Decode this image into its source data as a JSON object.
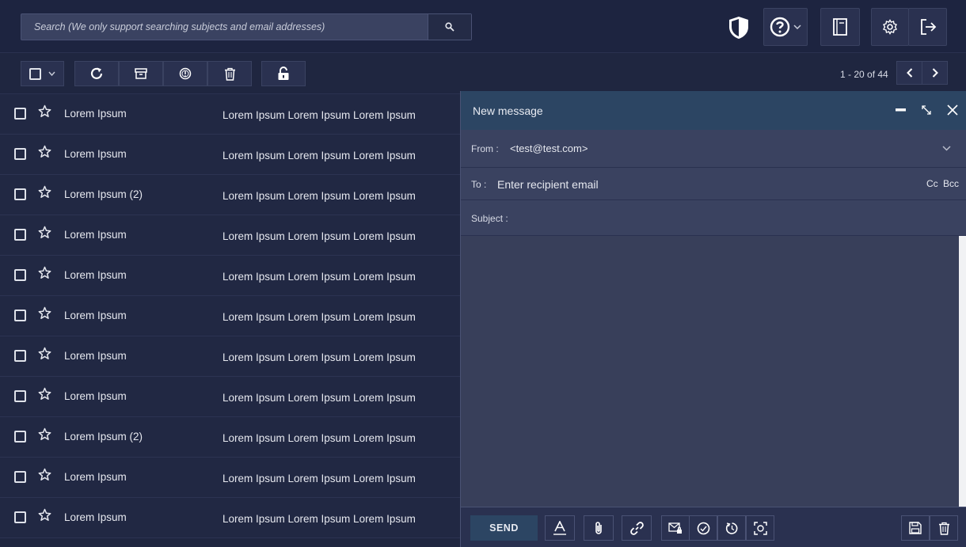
{
  "search": {
    "placeholder": "Search (We only support searching subjects and email addresses)"
  },
  "icons": {
    "search": "search-icon",
    "shield": "shield-icon",
    "help": "help-icon",
    "notebook": "notebook-icon",
    "settings": "gear-icon",
    "logout": "logout-icon",
    "refresh": "refresh-icon",
    "archive": "archive-icon",
    "spam": "spam-icon",
    "trash": "trash-icon",
    "unlock": "unlock-icon"
  },
  "pager": {
    "text": "1 - 20 of 44"
  },
  "messages": [
    {
      "sender": "Lorem Ipsum",
      "subject": "Lorem Ipsum Lorem Ipsum Lorem Ipsum"
    },
    {
      "sender": "Lorem Ipsum",
      "subject": "Lorem Ipsum Lorem Ipsum Lorem Ipsum"
    },
    {
      "sender": "Lorem Ipsum (2)",
      "subject": "Lorem Ipsum Lorem Ipsum Lorem Ipsum"
    },
    {
      "sender": "Lorem Ipsum",
      "subject": "Lorem Ipsum Lorem Ipsum Lorem Ipsum"
    },
    {
      "sender": "Lorem Ipsum",
      "subject": "Lorem Ipsum Lorem Ipsum Lorem Ipsum"
    },
    {
      "sender": "Lorem Ipsum",
      "subject": "Lorem Ipsum Lorem Ipsum Lorem Ipsum"
    },
    {
      "sender": "Lorem Ipsum",
      "subject": "Lorem Ipsum Lorem Ipsum Lorem Ipsum"
    },
    {
      "sender": "Lorem Ipsum",
      "subject": "Lorem Ipsum Lorem Ipsum Lorem Ipsum"
    },
    {
      "sender": "Lorem Ipsum (2)",
      "subject": "Lorem Ipsum Lorem Ipsum Lorem Ipsum"
    },
    {
      "sender": "Lorem Ipsum",
      "subject": "Lorem Ipsum Lorem Ipsum Lorem Ipsum"
    },
    {
      "sender": "Lorem Ipsum",
      "subject": "Lorem Ipsum Lorem Ipsum Lorem Ipsum"
    }
  ],
  "compose": {
    "title": "New message",
    "from_label": "From :",
    "from_value": "<test@test.com>",
    "to_label": "To :",
    "to_placeholder": "Enter recipient email",
    "cc_label": "Cc",
    "bcc_label": "Bcc",
    "subject_label": "Subject :",
    "send_label": "SEND"
  },
  "colors": {
    "accent": "#2c4563",
    "background": "#1f2640",
    "compose": "#383f5a"
  }
}
